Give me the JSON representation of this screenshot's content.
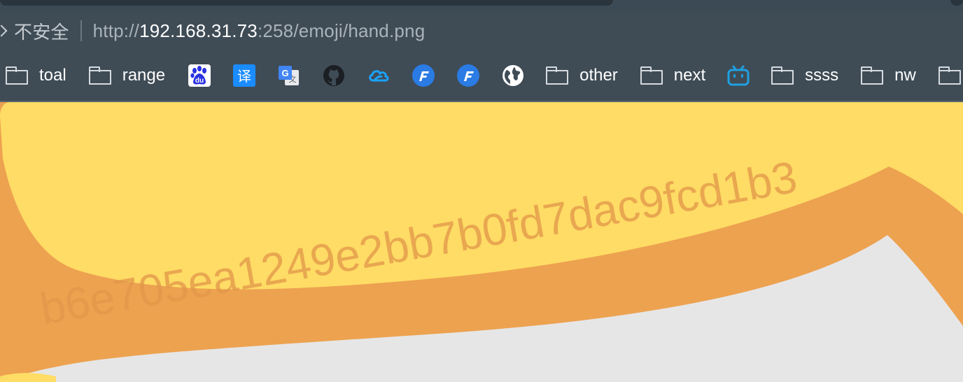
{
  "address_bar": {
    "security_label": "不安全",
    "url_scheme": "http://",
    "url_host": "192.168.31.73",
    "url_rest": ":258/emoji/hand.png"
  },
  "bookmarks": [
    {
      "type": "folder",
      "label": "toal"
    },
    {
      "type": "folder",
      "label": "range"
    },
    {
      "type": "favicon",
      "icon": "baidu-icon",
      "glyph": "du",
      "color": "#2932e1"
    },
    {
      "type": "favicon",
      "icon": "translate-icon",
      "glyph": "译",
      "color": "#1a8cff"
    },
    {
      "type": "favicon",
      "icon": "google-translate-icon",
      "glyph": "G",
      "color": "#4285f4"
    },
    {
      "type": "favicon",
      "icon": "github-icon",
      "color": "#1b1f23"
    },
    {
      "type": "favicon",
      "icon": "cloud-icon",
      "color": "#1aa3ff"
    },
    {
      "type": "favicon",
      "icon": "f-logo-icon",
      "glyph": "F",
      "color": "#2a7be4"
    },
    {
      "type": "favicon",
      "icon": "f-logo-icon",
      "glyph": "F",
      "color": "#2a7be4"
    },
    {
      "type": "favicon",
      "icon": "globe-icon",
      "color": "#ffffff"
    },
    {
      "type": "folder",
      "label": "other"
    },
    {
      "type": "folder",
      "label": "next"
    },
    {
      "type": "favicon",
      "icon": "bilibili-icon",
      "color": "#1fa0e0"
    },
    {
      "type": "folder",
      "label": "ssss"
    },
    {
      "type": "folder",
      "label": "nw"
    }
  ],
  "image": {
    "watermark": "b6e705ea1249e2bb7b0fd7dac9fcd1b3",
    "fill_color": "#ffdc65",
    "outline_color": "#eda250",
    "background_color": "#e6e6e6"
  }
}
